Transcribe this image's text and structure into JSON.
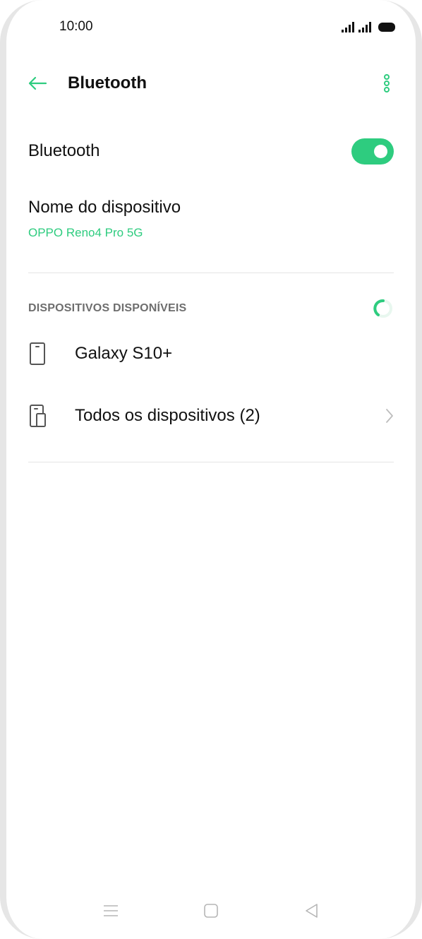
{
  "status_bar": {
    "time": "10:00",
    "icons": [
      "signal-icon",
      "signal-icon",
      "battery-icon"
    ]
  },
  "header": {
    "title": "Bluetooth",
    "back_icon": "arrow-left-icon",
    "menu_icon": "more-vertical-icon"
  },
  "bluetooth_toggle": {
    "label": "Bluetooth",
    "state": "on"
  },
  "device_name": {
    "title": "Nome do dispositivo",
    "value": "OPPO Reno4 Pro 5G"
  },
  "available_devices": {
    "section_title": "DISPOSITIVOS DISPONÍVEIS",
    "status_icon": "loading-spinner-icon",
    "items": [
      {
        "label": "Galaxy S10+",
        "icon": "phone-icon"
      },
      {
        "label": "Todos os dispositivos (2)",
        "icon": "devices-icon",
        "trailing_icon": "chevron-right-icon"
      }
    ]
  },
  "nav_bar": {
    "items": [
      "menu-icon",
      "home-icon",
      "back-icon"
    ]
  },
  "colors": {
    "accent": "#2ecc7f",
    "text": "#111111",
    "secondary_text": "#6e6e6e",
    "divider": "#e4e4e4",
    "nav_icon": "#b5b5b5"
  }
}
